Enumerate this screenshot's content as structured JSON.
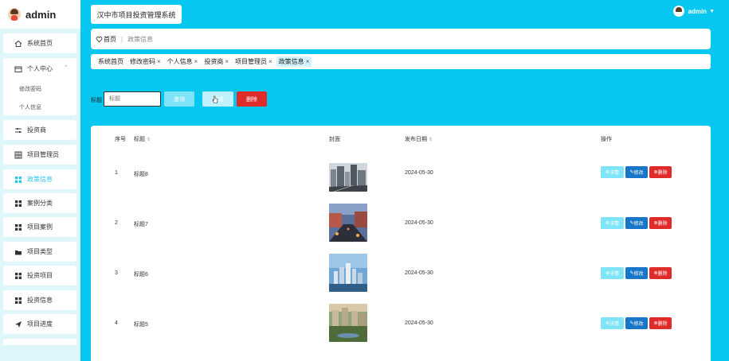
{
  "brand": {
    "name": "admin"
  },
  "app_title": "汉中市项目投资管理系统",
  "user": {
    "name": "admin"
  },
  "sidebar": {
    "home": "系统首页",
    "personal_center": "个人中心",
    "sub_items": [
      "修改密码",
      "个人信息"
    ],
    "items": [
      {
        "label": "投资商",
        "icon": "sliders-icon"
      },
      {
        "label": "项目管理员",
        "icon": "grid-icon"
      },
      {
        "label": "政策信息",
        "icon": "apps-icon",
        "active": true
      },
      {
        "label": "案例分类",
        "icon": "apps-icon"
      },
      {
        "label": "项目案例",
        "icon": "apps-icon"
      },
      {
        "label": "项目类型",
        "icon": "folder-icon"
      },
      {
        "label": "投资项目",
        "icon": "apps-icon"
      },
      {
        "label": "投资信息",
        "icon": "apps-icon"
      },
      {
        "label": "项目进度",
        "icon": "send-icon"
      }
    ]
  },
  "breadcrumb": {
    "home": "首页",
    "current": "政策信息"
  },
  "tags": [
    "系统首页",
    "修改密码",
    "个人信息",
    "投资商",
    "项目管理员",
    "政策信息"
  ],
  "search": {
    "label": "标题",
    "placeholder": "标题",
    "query_label": "查询",
    "add_label": "新增",
    "delete_label": "删除"
  },
  "table": {
    "headers": {
      "index": "序号",
      "title": "标题",
      "cover": "封面",
      "date": "发布日期",
      "actions": "操作"
    },
    "rows": [
      {
        "index": "1",
        "title": "标题8",
        "date": "2024-05-30",
        "cover": "city-street-photo"
      },
      {
        "index": "2",
        "title": "标题7",
        "date": "2024-05-30",
        "cover": "evening-road-photo"
      },
      {
        "index": "3",
        "title": "标题6",
        "date": "2024-05-30",
        "cover": "skyline-photo"
      },
      {
        "index": "4",
        "title": "标题5",
        "date": "2024-05-30",
        "cover": "residential-park-photo"
      }
    ],
    "action_labels": {
      "view": "详情",
      "edit": "修改",
      "delete": "删除"
    }
  },
  "colors": {
    "background": "#06c7f0",
    "accent": "#27c6f0",
    "edit": "#1876c9",
    "danger": "#e02b2b"
  }
}
